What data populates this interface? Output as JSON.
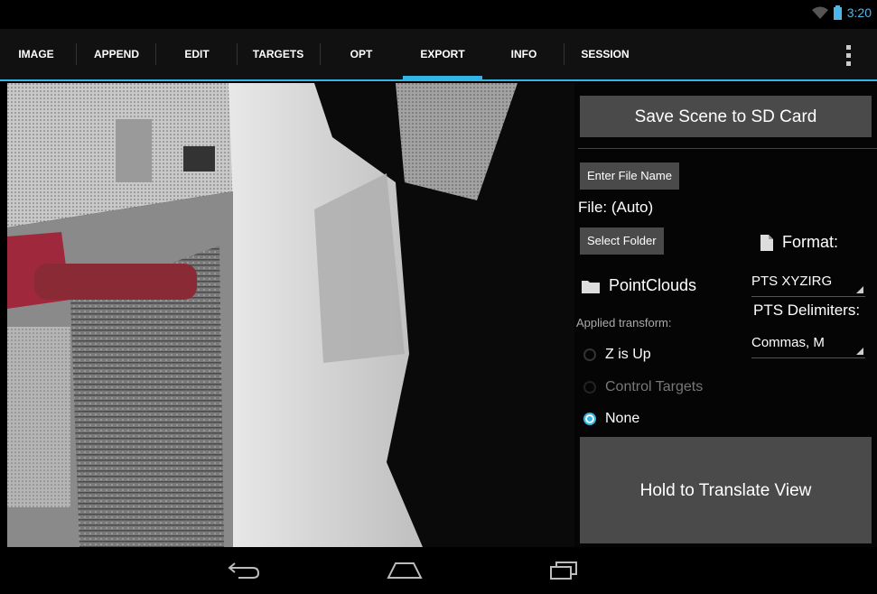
{
  "status": {
    "time": "3:20"
  },
  "tabs": [
    {
      "label": "IMAGE"
    },
    {
      "label": "APPEND"
    },
    {
      "label": "EDIT"
    },
    {
      "label": "TARGETS"
    },
    {
      "label": "OPT"
    },
    {
      "label": "EXPORT",
      "active": true
    },
    {
      "label": "INFO"
    },
    {
      "label": "SESSION"
    }
  ],
  "panel": {
    "save_label": "Save Scene to SD Card",
    "enter_file_name_label": "Enter File Name",
    "file_text": "File: (Auto)",
    "select_folder_label": "Select Folder",
    "format_label": "Format:",
    "folder_name": "PointClouds",
    "format_value": "PTS XYZIRG",
    "applied_transform_label": "Applied transform:",
    "delimiters_label": "PTS Delimiters:",
    "delimiters_value": "Commas, M",
    "radio_options": [
      {
        "label": "Z is Up",
        "selected": false,
        "enabled": true
      },
      {
        "label": "Control Targets",
        "selected": false,
        "enabled": false
      },
      {
        "label": "None",
        "selected": true,
        "enabled": true
      }
    ],
    "hold_label": "Hold to Translate View"
  },
  "colors": {
    "accent": "#33b5e5",
    "button": "#4a4a4a"
  },
  "icons": [
    "wifi-icon",
    "battery-icon",
    "overflow-menu-icon",
    "document-icon",
    "folder-icon",
    "back-icon",
    "home-icon",
    "recents-icon"
  ]
}
